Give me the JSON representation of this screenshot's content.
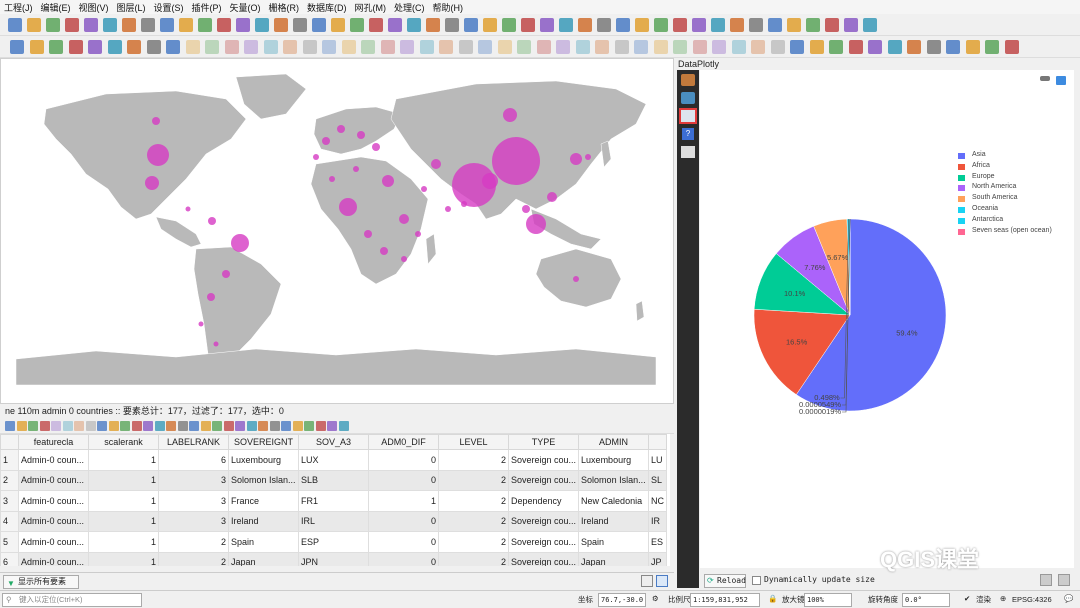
{
  "menu": [
    "工程(J)",
    "编辑(E)",
    "视图(V)",
    "图层(L)",
    "设置(S)",
    "插件(P)",
    "矢量(O)",
    "栅格(R)",
    "数据库(D)",
    "网孔(M)",
    "处理(C)",
    "帮助(H)"
  ],
  "layer_status": "ne 110m admin 0 countries :: 要素总计：177，过滤了：177，选中：0",
  "table": {
    "columns": [
      "featurecla",
      "scalerank",
      "LABELRANK",
      "SOVEREIGNT",
      "SOV_A3",
      "ADM0_DIF",
      "LEVEL",
      "TYPE",
      "ADMIN"
    ],
    "rows": [
      [
        "1",
        "Admin-0 coun...",
        "1",
        "6",
        "Luxembourg",
        "LUX",
        "0",
        "2",
        "Sovereign cou...",
        "Luxembourg",
        "LU"
      ],
      [
        "2",
        "Admin-0 coun...",
        "1",
        "3",
        "Solomon Islan...",
        "SLB",
        "0",
        "2",
        "Sovereign cou...",
        "Solomon Islan...",
        "SL"
      ],
      [
        "3",
        "Admin-0 coun...",
        "1",
        "3",
        "France",
        "FR1",
        "1",
        "2",
        "Dependency",
        "New Caledonia",
        "NC"
      ],
      [
        "4",
        "Admin-0 coun...",
        "1",
        "3",
        "Ireland",
        "IRL",
        "0",
        "2",
        "Sovereign cou...",
        "Ireland",
        "IR"
      ],
      [
        "5",
        "Admin-0 coun...",
        "1",
        "2",
        "Spain",
        "ESP",
        "0",
        "2",
        "Sovereign cou...",
        "Spain",
        "ES"
      ],
      [
        "6",
        "Admin-0 coun...",
        "1",
        "2",
        "Japan",
        "JPN",
        "0",
        "2",
        "Sovereign cou...",
        "Japan",
        "JP"
      ]
    ]
  },
  "attr_footer": {
    "show_all": "显示所有要素"
  },
  "panel_title": "DataPlotly",
  "plot_bottom": {
    "reload": "Reload",
    "dynamic": "Dynamically update size"
  },
  "status": {
    "locator_placeholder": "键入以定位(Ctrl+K)",
    "coord_label": "坐标",
    "coord_value": "76.7,-30.0",
    "scale_label": "比例尺",
    "scale_value": "1:159,831,952",
    "magnifier_label": "放大镜",
    "magnifier_value": "100%",
    "rotation_label": "旋转角度",
    "rotation_value": "0.0°",
    "render_label": "渲染",
    "crs": "EPSG:4326"
  },
  "watermark": "QGIS课堂",
  "chart_data": {
    "type": "pie",
    "categories": [
      "Asia",
      "Africa",
      "Europe",
      "North America",
      "South America",
      "Oceania",
      "Antarctica",
      "Seven seas (open ocean)"
    ],
    "values": [
      59.4,
      16.5,
      10.1,
      7.76,
      5.67,
      0.498,
      5.49e-05,
      1.9e-06
    ],
    "labels": [
      "59.4%",
      "16.5%",
      "10.1%",
      "7.76%",
      "5.67%",
      "0.498%",
      "0.0000549%",
      "0.0000019%"
    ],
    "colors": [
      "#636efa",
      "#ef553b",
      "#00cc96",
      "#ab63fa",
      "#ffa15a",
      "#19d3f3",
      "#19d3f3",
      "#ff6692"
    ],
    "legend_position": "top-right"
  },
  "map_colors": {
    "land": "#b9b9b9",
    "bubble": "#d63bc3"
  }
}
